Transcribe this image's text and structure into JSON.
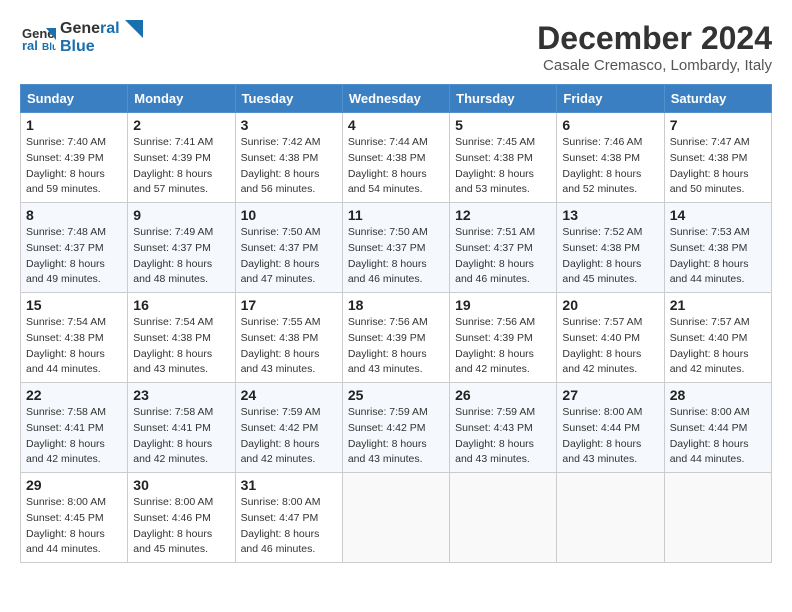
{
  "header": {
    "logo_line1": "General",
    "logo_line2": "Blue",
    "month_title": "December 2024",
    "location": "Casale Cremasco, Lombardy, Italy"
  },
  "days_of_week": [
    "Sunday",
    "Monday",
    "Tuesday",
    "Wednesday",
    "Thursday",
    "Friday",
    "Saturday"
  ],
  "weeks": [
    [
      {
        "day": "1",
        "sunrise": "7:40 AM",
        "sunset": "4:39 PM",
        "daylight_hours": "8",
        "daylight_minutes": "59"
      },
      {
        "day": "2",
        "sunrise": "7:41 AM",
        "sunset": "4:39 PM",
        "daylight_hours": "8",
        "daylight_minutes": "57"
      },
      {
        "day": "3",
        "sunrise": "7:42 AM",
        "sunset": "4:38 PM",
        "daylight_hours": "8",
        "daylight_minutes": "56"
      },
      {
        "day": "4",
        "sunrise": "7:44 AM",
        "sunset": "4:38 PM",
        "daylight_hours": "8",
        "daylight_minutes": "54"
      },
      {
        "day": "5",
        "sunrise": "7:45 AM",
        "sunset": "4:38 PM",
        "daylight_hours": "8",
        "daylight_minutes": "53"
      },
      {
        "day": "6",
        "sunrise": "7:46 AM",
        "sunset": "4:38 PM",
        "daylight_hours": "8",
        "daylight_minutes": "52"
      },
      {
        "day": "7",
        "sunrise": "7:47 AM",
        "sunset": "4:38 PM",
        "daylight_hours": "8",
        "daylight_minutes": "50"
      }
    ],
    [
      {
        "day": "8",
        "sunrise": "7:48 AM",
        "sunset": "4:37 PM",
        "daylight_hours": "8",
        "daylight_minutes": "49"
      },
      {
        "day": "9",
        "sunrise": "7:49 AM",
        "sunset": "4:37 PM",
        "daylight_hours": "8",
        "daylight_minutes": "48"
      },
      {
        "day": "10",
        "sunrise": "7:50 AM",
        "sunset": "4:37 PM",
        "daylight_hours": "8",
        "daylight_minutes": "47"
      },
      {
        "day": "11",
        "sunrise": "7:50 AM",
        "sunset": "4:37 PM",
        "daylight_hours": "8",
        "daylight_minutes": "46"
      },
      {
        "day": "12",
        "sunrise": "7:51 AM",
        "sunset": "4:37 PM",
        "daylight_hours": "8",
        "daylight_minutes": "46"
      },
      {
        "day": "13",
        "sunrise": "7:52 AM",
        "sunset": "4:38 PM",
        "daylight_hours": "8",
        "daylight_minutes": "45"
      },
      {
        "day": "14",
        "sunrise": "7:53 AM",
        "sunset": "4:38 PM",
        "daylight_hours": "8",
        "daylight_minutes": "44"
      }
    ],
    [
      {
        "day": "15",
        "sunrise": "7:54 AM",
        "sunset": "4:38 PM",
        "daylight_hours": "8",
        "daylight_minutes": "44"
      },
      {
        "day": "16",
        "sunrise": "7:54 AM",
        "sunset": "4:38 PM",
        "daylight_hours": "8",
        "daylight_minutes": "43"
      },
      {
        "day": "17",
        "sunrise": "7:55 AM",
        "sunset": "4:38 PM",
        "daylight_hours": "8",
        "daylight_minutes": "43"
      },
      {
        "day": "18",
        "sunrise": "7:56 AM",
        "sunset": "4:39 PM",
        "daylight_hours": "8",
        "daylight_minutes": "43"
      },
      {
        "day": "19",
        "sunrise": "7:56 AM",
        "sunset": "4:39 PM",
        "daylight_hours": "8",
        "daylight_minutes": "42"
      },
      {
        "day": "20",
        "sunrise": "7:57 AM",
        "sunset": "4:40 PM",
        "daylight_hours": "8",
        "daylight_minutes": "42"
      },
      {
        "day": "21",
        "sunrise": "7:57 AM",
        "sunset": "4:40 PM",
        "daylight_hours": "8",
        "daylight_minutes": "42"
      }
    ],
    [
      {
        "day": "22",
        "sunrise": "7:58 AM",
        "sunset": "4:41 PM",
        "daylight_hours": "8",
        "daylight_minutes": "42"
      },
      {
        "day": "23",
        "sunrise": "7:58 AM",
        "sunset": "4:41 PM",
        "daylight_hours": "8",
        "daylight_minutes": "42"
      },
      {
        "day": "24",
        "sunrise": "7:59 AM",
        "sunset": "4:42 PM",
        "daylight_hours": "8",
        "daylight_minutes": "42"
      },
      {
        "day": "25",
        "sunrise": "7:59 AM",
        "sunset": "4:42 PM",
        "daylight_hours": "8",
        "daylight_minutes": "43"
      },
      {
        "day": "26",
        "sunrise": "7:59 AM",
        "sunset": "4:43 PM",
        "daylight_hours": "8",
        "daylight_minutes": "43"
      },
      {
        "day": "27",
        "sunrise": "8:00 AM",
        "sunset": "4:44 PM",
        "daylight_hours": "8",
        "daylight_minutes": "43"
      },
      {
        "day": "28",
        "sunrise": "8:00 AM",
        "sunset": "4:44 PM",
        "daylight_hours": "8",
        "daylight_minutes": "44"
      }
    ],
    [
      {
        "day": "29",
        "sunrise": "8:00 AM",
        "sunset": "4:45 PM",
        "daylight_hours": "8",
        "daylight_minutes": "44"
      },
      {
        "day": "30",
        "sunrise": "8:00 AM",
        "sunset": "4:46 PM",
        "daylight_hours": "8",
        "daylight_minutes": "45"
      },
      {
        "day": "31",
        "sunrise": "8:00 AM",
        "sunset": "4:47 PM",
        "daylight_hours": "8",
        "daylight_minutes": "46"
      },
      null,
      null,
      null,
      null
    ]
  ],
  "labels": {
    "sunrise": "Sunrise:",
    "sunset": "Sunset:",
    "daylight": "Daylight:"
  }
}
